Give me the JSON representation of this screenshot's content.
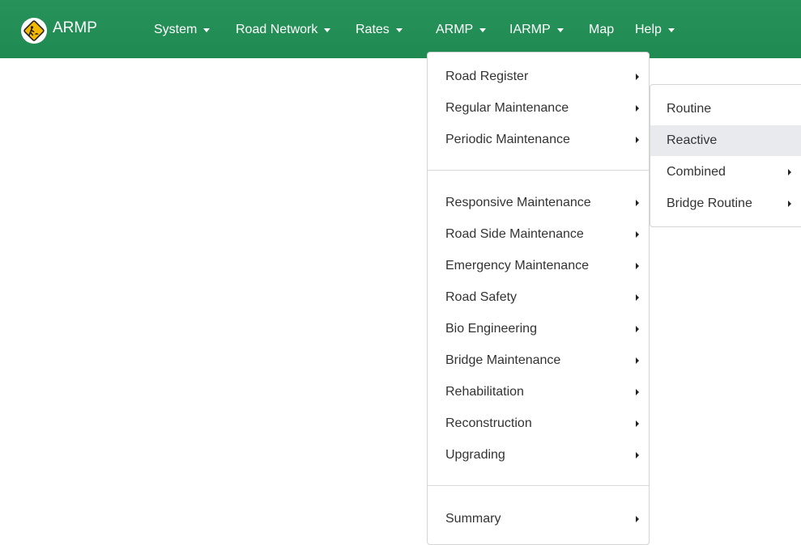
{
  "app": {
    "title": "ARMP",
    "logo_icon": "road-work-sign-icon"
  },
  "navbar": {
    "background": "#219255",
    "items": [
      {
        "label": "System",
        "has_dropdown": true
      },
      {
        "label": "Road Network",
        "has_dropdown": true
      },
      {
        "label": "Rates",
        "has_dropdown": true
      },
      {
        "label": "ARMP",
        "has_dropdown": true
      },
      {
        "label": "IARMP",
        "has_dropdown": true
      },
      {
        "label": "Map",
        "has_dropdown": false
      },
      {
        "label": "Help",
        "has_dropdown": true
      }
    ]
  },
  "armp_menu": {
    "groups": [
      [
        {
          "label": "Road Register",
          "has_submenu": true
        },
        {
          "label": "Regular Maintenance",
          "has_submenu": true
        },
        {
          "label": "Periodic Maintenance",
          "has_submenu": true
        }
      ],
      [
        {
          "label": "Responsive Maintenance",
          "has_submenu": true
        },
        {
          "label": "Road Side Maintenance",
          "has_submenu": true
        },
        {
          "label": "Emergency Maintenance",
          "has_submenu": true
        },
        {
          "label": "Road Safety",
          "has_submenu": true
        },
        {
          "label": "Bio Engineering",
          "has_submenu": true
        },
        {
          "label": "Bridge Maintenance",
          "has_submenu": true
        },
        {
          "label": "Rehabilitation",
          "has_submenu": true
        },
        {
          "label": "Reconstruction",
          "has_submenu": true
        },
        {
          "label": "Upgrading",
          "has_submenu": true
        }
      ],
      [
        {
          "label": "Summary",
          "has_submenu": true
        }
      ]
    ]
  },
  "regular_maintenance_submenu": {
    "items": [
      {
        "label": "Routine",
        "has_submenu": false,
        "active": false
      },
      {
        "label": "Reactive",
        "has_submenu": false,
        "active": true
      },
      {
        "label": "Combined",
        "has_submenu": true,
        "active": false
      },
      {
        "label": "Bridge Routine",
        "has_submenu": true,
        "active": false
      }
    ]
  }
}
